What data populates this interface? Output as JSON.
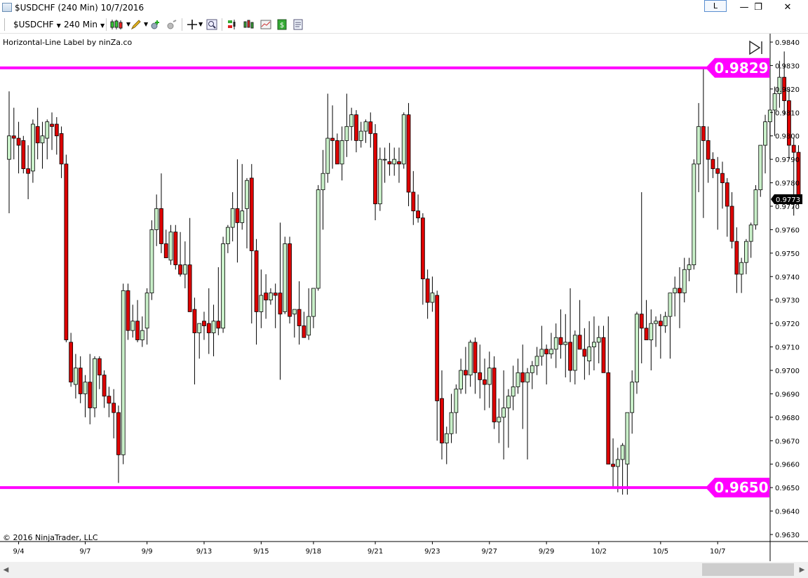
{
  "window": {
    "title": "$USDCHF (240 Min)  10/7/2016",
    "min_glyph": "—",
    "restore_glyph": "❐",
    "close_glyph": "✕",
    "l_button": "L"
  },
  "toolbar": {
    "instrument": "$USDCHF",
    "interval": "240 Min",
    "icons": [
      "candlestick-style-icon",
      "pencil-draw-icon",
      "add-indicator-icon",
      "add-strategy-icon",
      "crosshair-icon",
      "zoom-icon",
      "chart-trader-icon",
      "bar-type-icon",
      "data-box-icon",
      "dollar-icon",
      "properties-icon"
    ]
  },
  "chart": {
    "indicator_label": "Horizontal-Line Label by ninZa.co",
    "copyright": "© 2016 NinjaTrader, LLC",
    "colors": {
      "up_fill": "#c9f0c9",
      "down_fill": "#dd0000",
      "wick": "#000000",
      "hline": "#ff00ff",
      "label_text": "#ffffff",
      "last_price_bg": "#000000"
    },
    "price_axis": {
      "min": 0.963,
      "max": 0.984,
      "step": 0.001,
      "ticks": [
        "0.9840",
        "0.9830",
        "0.9820",
        "0.9810",
        "0.9800",
        "0.9790",
        "0.9780",
        "0.9770",
        "0.9760",
        "0.9750",
        "0.9740",
        "0.9730",
        "0.9720",
        "0.9710",
        "0.9700",
        "0.9690",
        "0.9680",
        "0.9670",
        "0.9660",
        "0.9650",
        "0.9640",
        "0.9630"
      ]
    },
    "time_axis": {
      "labels": [
        {
          "text": "9/4",
          "bar": 2
        },
        {
          "text": "9/7",
          "bar": 16
        },
        {
          "text": "9/9",
          "bar": 29
        },
        {
          "text": "9/13",
          "bar": 41
        },
        {
          "text": "9/15",
          "bar": 53
        },
        {
          "text": "9/18",
          "bar": 64
        },
        {
          "text": "9/21",
          "bar": 77
        },
        {
          "text": "9/23",
          "bar": 89
        },
        {
          "text": "9/27",
          "bar": 101
        },
        {
          "text": "9/29",
          "bar": 113
        },
        {
          "text": "10/2",
          "bar": 124
        },
        {
          "text": "10/5",
          "bar": 137
        },
        {
          "text": "10/7",
          "bar": 149
        }
      ]
    },
    "horizontal_lines": [
      {
        "price": 0.9829,
        "label": "0.9829"
      },
      {
        "price": 0.965,
        "label": "0.9650"
      }
    ],
    "last_price": {
      "price": 0.9773,
      "label": "0.9773"
    }
  },
  "chart_data": {
    "type": "candlestick",
    "symbol": "$USDCHF",
    "interval": "240 Min",
    "ohlc": [
      [
        0.979,
        0.9819,
        0.9767,
        0.98
      ],
      [
        0.98,
        0.9812,
        0.979,
        0.9799
      ],
      [
        0.9799,
        0.9806,
        0.9784,
        0.9796
      ],
      [
        0.9798,
        0.98,
        0.9784,
        0.9786
      ],
      [
        0.9786,
        0.9796,
        0.9773,
        0.9784
      ],
      [
        0.9785,
        0.9807,
        0.978,
        0.9805
      ],
      [
        0.9804,
        0.9812,
        0.979,
        0.9797
      ],
      [
        0.9797,
        0.9806,
        0.9786,
        0.98
      ],
      [
        0.9799,
        0.9807,
        0.979,
        0.9806
      ],
      [
        0.9805,
        0.981,
        0.9794,
        0.9804
      ],
      [
        0.9805,
        0.9808,
        0.9792,
        0.98
      ],
      [
        0.9801,
        0.9804,
        0.9782,
        0.9788
      ],
      [
        0.9788,
        0.9792,
        0.9712,
        0.9713
      ],
      [
        0.9712,
        0.9716,
        0.9693,
        0.9695
      ],
      [
        0.9694,
        0.9707,
        0.9688,
        0.9701
      ],
      [
        0.9701,
        0.9706,
        0.9686,
        0.969
      ],
      [
        0.969,
        0.9698,
        0.968,
        0.9695
      ],
      [
        0.9695,
        0.9707,
        0.9677,
        0.9684
      ],
      [
        0.9684,
        0.9706,
        0.968,
        0.9705
      ],
      [
        0.9705,
        0.9706,
        0.9692,
        0.9698
      ],
      [
        0.9698,
        0.97,
        0.9684,
        0.9689
      ],
      [
        0.9689,
        0.9693,
        0.968,
        0.9686
      ],
      [
        0.9686,
        0.9692,
        0.9671,
        0.9682
      ],
      [
        0.9682,
        0.9685,
        0.9652,
        0.9664
      ],
      [
        0.9664,
        0.9737,
        0.966,
        0.9734
      ],
      [
        0.9734,
        0.9737,
        0.9713,
        0.9717
      ],
      [
        0.9717,
        0.9728,
        0.9714,
        0.9721
      ],
      [
        0.9721,
        0.973,
        0.9712,
        0.9713
      ],
      [
        0.9713,
        0.9723,
        0.971,
        0.9717
      ],
      [
        0.9718,
        0.9735,
        0.9711,
        0.9733
      ],
      [
        0.9733,
        0.9764,
        0.973,
        0.976
      ],
      [
        0.976,
        0.9775,
        0.9753,
        0.9769
      ],
      [
        0.9769,
        0.9784,
        0.975,
        0.9754
      ],
      [
        0.9754,
        0.976,
        0.9748,
        0.9748
      ],
      [
        0.9747,
        0.9762,
        0.9745,
        0.9759
      ],
      [
        0.9759,
        0.9762,
        0.9743,
        0.9745
      ],
      [
        0.9745,
        0.9759,
        0.974,
        0.9741
      ],
      [
        0.9741,
        0.9755,
        0.9735,
        0.9745
      ],
      [
        0.9745,
        0.9765,
        0.9725,
        0.9725
      ],
      [
        0.9726,
        0.9731,
        0.9694,
        0.9716
      ],
      [
        0.9716,
        0.972,
        0.9705,
        0.972
      ],
      [
        0.9721,
        0.9725,
        0.9713,
        0.9719
      ],
      [
        0.972,
        0.9735,
        0.9707,
        0.9716
      ],
      [
        0.9716,
        0.9728,
        0.9706,
        0.9721
      ],
      [
        0.9721,
        0.9744,
        0.9715,
        0.9718
      ],
      [
        0.9718,
        0.9757,
        0.9716,
        0.9754
      ],
      [
        0.9754,
        0.9762,
        0.975,
        0.9761
      ],
      [
        0.9761,
        0.9776,
        0.9755,
        0.9769
      ],
      [
        0.9769,
        0.979,
        0.9746,
        0.9763
      ],
      [
        0.9763,
        0.9788,
        0.976,
        0.9768
      ],
      [
        0.9769,
        0.9782,
        0.9752,
        0.9781
      ],
      [
        0.9782,
        0.9788,
        0.972,
        0.9751
      ],
      [
        0.9751,
        0.9756,
        0.9711,
        0.9725
      ],
      [
        0.9725,
        0.9743,
        0.9718,
        0.9732
      ],
      [
        0.9733,
        0.9741,
        0.9722,
        0.973
      ],
      [
        0.973,
        0.9735,
        0.9728,
        0.9733
      ],
      [
        0.9733,
        0.9737,
        0.9718,
        0.9732
      ],
      [
        0.9733,
        0.9763,
        0.9696,
        0.9724
      ],
      [
        0.9725,
        0.9757,
        0.9724,
        0.9754
      ],
      [
        0.9754,
        0.9757,
        0.972,
        0.9723
      ],
      [
        0.9724,
        0.9725,
        0.9714,
        0.9726
      ],
      [
        0.9726,
        0.9738,
        0.9711,
        0.9719
      ],
      [
        0.9719,
        0.9725,
        0.9715,
        0.9714
      ],
      [
        0.9715,
        0.9735,
        0.9713,
        0.9723
      ],
      [
        0.9723,
        0.9728,
        0.9718,
        0.9735
      ],
      [
        0.9735,
        0.9779,
        0.9734,
        0.9777
      ],
      [
        0.9777,
        0.9794,
        0.976,
        0.9784
      ],
      [
        0.9784,
        0.9818,
        0.978,
        0.9799
      ],
      [
        0.9799,
        0.9813,
        0.9786,
        0.9798
      ],
      [
        0.9798,
        0.9801,
        0.9788,
        0.9788
      ],
      [
        0.9788,
        0.9804,
        0.9781,
        0.9798
      ],
      [
        0.9798,
        0.9818,
        0.9791,
        0.9804
      ],
      [
        0.9804,
        0.9812,
        0.9798,
        0.9809
      ],
      [
        0.9809,
        0.9811,
        0.9793,
        0.9798
      ],
      [
        0.9798,
        0.9806,
        0.9795,
        0.9802
      ],
      [
        0.9802,
        0.9807,
        0.9797,
        0.9806
      ],
      [
        0.9806,
        0.981,
        0.9795,
        0.9801
      ],
      [
        0.9801,
        0.9805,
        0.9764,
        0.9771
      ],
      [
        0.9771,
        0.9795,
        0.9768,
        0.979
      ],
      [
        0.979,
        0.9795,
        0.978,
        0.979
      ],
      [
        0.9789,
        0.9797,
        0.9783,
        0.9788
      ],
      [
        0.9788,
        0.9795,
        0.9783,
        0.979
      ],
      [
        0.9789,
        0.9795,
        0.978,
        0.9788
      ],
      [
        0.9788,
        0.981,
        0.9786,
        0.9809
      ],
      [
        0.9809,
        0.9814,
        0.977,
        0.9776
      ],
      [
        0.9776,
        0.9785,
        0.9762,
        0.9768
      ],
      [
        0.9768,
        0.9775,
        0.9763,
        0.9765
      ],
      [
        0.9765,
        0.9767,
        0.9728,
        0.9739
      ],
      [
        0.9739,
        0.9743,
        0.9722,
        0.9729
      ],
      [
        0.9729,
        0.974,
        0.9725,
        0.9733
      ],
      [
        0.9732,
        0.9734,
        0.967,
        0.9687
      ],
      [
        0.9688,
        0.97,
        0.9662,
        0.9669
      ],
      [
        0.9669,
        0.9676,
        0.966,
        0.9673
      ],
      [
        0.9673,
        0.969,
        0.9669,
        0.9682
      ],
      [
        0.9682,
        0.9694,
        0.9673,
        0.9692
      ],
      [
        0.9692,
        0.9705,
        0.969,
        0.97
      ],
      [
        0.97,
        0.971,
        0.969,
        0.9698
      ],
      [
        0.9698,
        0.9713,
        0.9693,
        0.9712
      ],
      [
        0.9712,
        0.9714,
        0.969,
        0.9699
      ],
      [
        0.9699,
        0.9711,
        0.9688,
        0.9696
      ],
      [
        0.9696,
        0.9705,
        0.9683,
        0.9694
      ],
      [
        0.9694,
        0.9708,
        0.9684,
        0.9701
      ],
      [
        0.9701,
        0.9706,
        0.9675,
        0.9678
      ],
      [
        0.9678,
        0.9688,
        0.9669,
        0.968
      ],
      [
        0.968,
        0.97,
        0.9662,
        0.9684
      ],
      [
        0.9684,
        0.9692,
        0.9667,
        0.9689
      ],
      [
        0.9689,
        0.9702,
        0.9683,
        0.9693
      ],
      [
        0.9693,
        0.9705,
        0.969,
        0.9699
      ],
      [
        0.9699,
        0.9711,
        0.9675,
        0.9695
      ],
      [
        0.9695,
        0.9701,
        0.9662,
        0.9699
      ],
      [
        0.9699,
        0.9704,
        0.9692,
        0.9702
      ],
      [
        0.9702,
        0.971,
        0.9698,
        0.9706
      ],
      [
        0.9706,
        0.9719,
        0.9702,
        0.9709
      ],
      [
        0.9709,
        0.9711,
        0.9694,
        0.9707
      ],
      [
        0.9707,
        0.9716,
        0.9705,
        0.9709
      ],
      [
        0.9709,
        0.972,
        0.9701,
        0.9714
      ],
      [
        0.9714,
        0.9726,
        0.9705,
        0.9711
      ],
      [
        0.9711,
        0.9724,
        0.9697,
        0.9712
      ],
      [
        0.9712,
        0.9735,
        0.9695,
        0.97
      ],
      [
        0.97,
        0.9717,
        0.9694,
        0.9715
      ],
      [
        0.9715,
        0.973,
        0.9712,
        0.9709
      ],
      [
        0.9709,
        0.9718,
        0.9696,
        0.9706
      ],
      [
        0.9704,
        0.9721,
        0.9698,
        0.971
      ],
      [
        0.971,
        0.9723,
        0.97,
        0.9712
      ],
      [
        0.9712,
        0.9719,
        0.9703,
        0.9714
      ],
      [
        0.9714,
        0.9719,
        0.9699,
        0.9699
      ],
      [
        0.9699,
        0.9723,
        0.966,
        0.966
      ],
      [
        0.966,
        0.9671,
        0.965,
        0.9659
      ],
      [
        0.9659,
        0.9667,
        0.9648,
        0.9662
      ],
      [
        0.9662,
        0.9669,
        0.9647,
        0.9668
      ],
      [
        0.966,
        0.9675,
        0.9647,
        0.9682
      ],
      [
        0.9682,
        0.97,
        0.9673,
        0.9695
      ],
      [
        0.9695,
        0.9725,
        0.969,
        0.9724
      ],
      [
        0.9724,
        0.9776,
        0.9703,
        0.9718
      ],
      [
        0.9718,
        0.973,
        0.9714,
        0.9713
      ],
      [
        0.9713,
        0.9726,
        0.97,
        0.972
      ],
      [
        0.972,
        0.9723,
        0.971,
        0.9721
      ],
      [
        0.9721,
        0.9724,
        0.9705,
        0.9719
      ],
      [
        0.9719,
        0.9725,
        0.9716,
        0.9723
      ],
      [
        0.9723,
        0.9731,
        0.9705,
        0.9733
      ],
      [
        0.9733,
        0.974,
        0.9723,
        0.9735
      ],
      [
        0.9735,
        0.9744,
        0.9718,
        0.9733
      ],
      [
        0.9733,
        0.9748,
        0.9729,
        0.9743
      ],
      [
        0.9743,
        0.9748,
        0.9738,
        0.9745
      ],
      [
        0.9745,
        0.979,
        0.9743,
        0.9788
      ],
      [
        0.9788,
        0.9814,
        0.9776,
        0.9804
      ],
      [
        0.9804,
        0.9829,
        0.9765,
        0.9798
      ],
      [
        0.9798,
        0.9804,
        0.978,
        0.979
      ],
      [
        0.979,
        0.9793,
        0.9782,
        0.9786
      ],
      [
        0.9786,
        0.9791,
        0.976,
        0.9784
      ],
      [
        0.9784,
        0.9789,
        0.9769,
        0.978
      ],
      [
        0.978,
        0.9782,
        0.9757,
        0.977
      ],
      [
        0.977,
        0.9776,
        0.9752,
        0.9755
      ],
      [
        0.9755,
        0.9761,
        0.9733,
        0.9741
      ],
      [
        0.9741,
        0.9748,
        0.9733,
        0.9746
      ],
      [
        0.9746,
        0.9756,
        0.9741,
        0.9755
      ],
      [
        0.9755,
        0.9763,
        0.9748,
        0.9762
      ],
      [
        0.9762,
        0.9779,
        0.976,
        0.9777
      ],
      [
        0.9777,
        0.9796,
        0.9774,
        0.9796
      ],
      [
        0.9796,
        0.9809,
        0.9784,
        0.9806
      ],
      [
        0.9806,
        0.9811,
        0.979,
        0.9811
      ],
      [
        0.9811,
        0.9821,
        0.98,
        0.9818
      ],
      [
        0.9818,
        0.9832,
        0.9812,
        0.9825
      ],
      [
        0.9825,
        0.9836,
        0.9809,
        0.9815
      ],
      [
        0.9815,
        0.982,
        0.979,
        0.9796
      ],
      [
        0.9796,
        0.9799,
        0.9766,
        0.9793
      ],
      [
        0.9793,
        0.9796,
        0.977,
        0.9773
      ]
    ]
  }
}
